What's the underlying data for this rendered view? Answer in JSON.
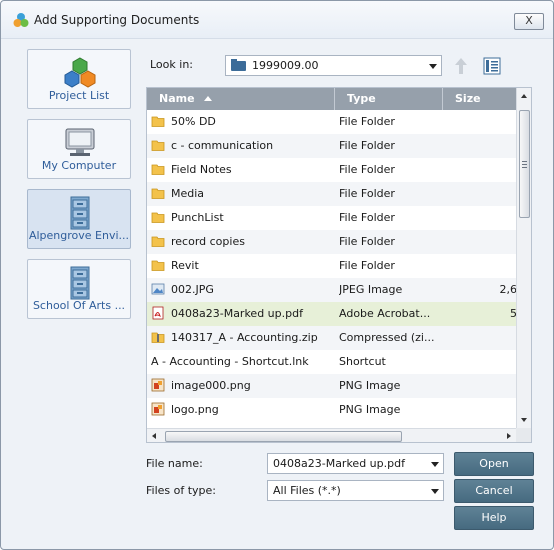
{
  "window": {
    "title": "Add Supporting Documents",
    "close_label": "X"
  },
  "places": [
    {
      "label": "Project List",
      "icon": "hexagon-cluster-icon"
    },
    {
      "label": "My Computer",
      "icon": "computer-icon"
    },
    {
      "label": "Alpengrove Envi...",
      "icon": "file-cabinet-icon"
    },
    {
      "label": "School Of Arts ...",
      "icon": "file-cabinet-icon"
    }
  ],
  "lookin": {
    "label": "Look in:",
    "value": "1999009.00"
  },
  "columns": {
    "name": "Name",
    "type": "Type",
    "size": "Size"
  },
  "files": [
    {
      "name": "50% DD",
      "type": "File Folder",
      "size": "",
      "icon": "folder-icon"
    },
    {
      "name": "c - communication",
      "type": "File Folder",
      "size": "",
      "icon": "folder-icon"
    },
    {
      "name": "Field Notes",
      "type": "File Folder",
      "size": "",
      "icon": "folder-icon"
    },
    {
      "name": "Media",
      "type": "File Folder",
      "size": "",
      "icon": "folder-icon"
    },
    {
      "name": "PunchList",
      "type": "File Folder",
      "size": "",
      "icon": "folder-icon"
    },
    {
      "name": "record copies",
      "type": "File Folder",
      "size": "",
      "icon": "folder-icon"
    },
    {
      "name": "Revit",
      "type": "File Folder",
      "size": "",
      "icon": "folder-icon"
    },
    {
      "name": "002.JPG",
      "type": "JPEG Image",
      "size": "2,6",
      "icon": "image-icon"
    },
    {
      "name": "0408a23-Marked up.pdf",
      "type": "Adobe Acrobat...",
      "size": "5",
      "icon": "pdf-icon",
      "selected": true
    },
    {
      "name": "140317_A - Accounting.zip",
      "type": "Compressed (zi...",
      "size": "",
      "icon": "zip-icon"
    },
    {
      "name": "A - Accounting - Shortcut.lnk",
      "type": "Shortcut",
      "size": "",
      "icon": ""
    },
    {
      "name": "image000.png",
      "type": "PNG Image",
      "size": "",
      "icon": "png-icon"
    },
    {
      "name": "logo.png",
      "type": "PNG Image",
      "size": "",
      "icon": "png-icon"
    }
  ],
  "filename": {
    "label": "File name:",
    "value": "0408a23-Marked up.pdf"
  },
  "filetype": {
    "label": "Files of type:",
    "value": "All Files (*.*)"
  },
  "buttons": {
    "open": "Open",
    "cancel": "Cancel",
    "help": "Help"
  },
  "colors": {
    "button_bg": "#5a7d91",
    "selected_row": "#e7f0d8",
    "header_bg": "#96a0ab",
    "link_text": "#2f5d9a"
  }
}
